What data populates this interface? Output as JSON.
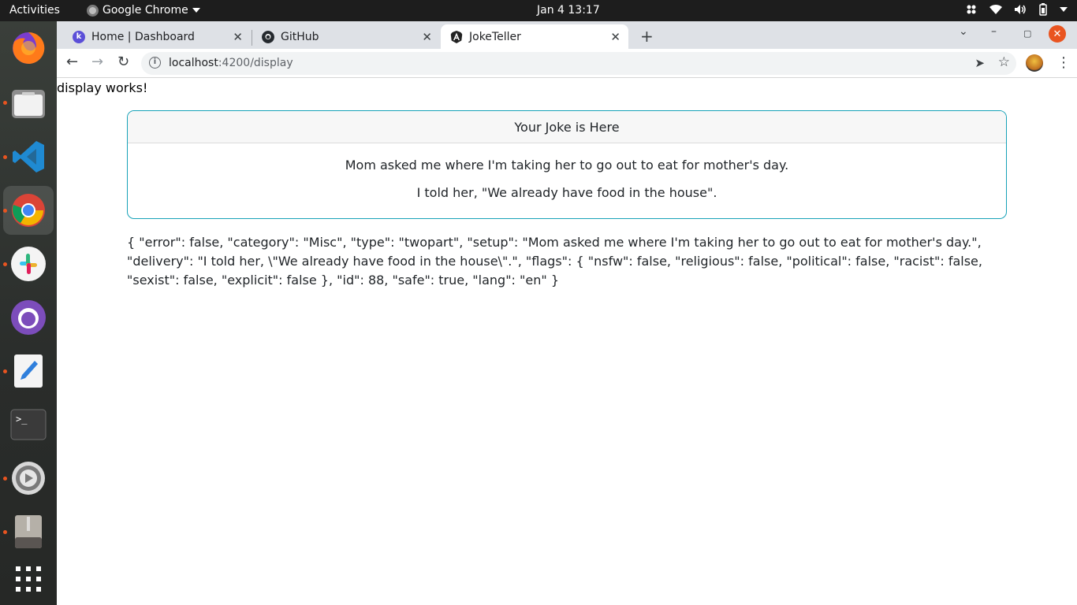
{
  "system": {
    "activities_label": "Activities",
    "app_menu_label": "Google Chrome",
    "clock": "Jan 4  13:17"
  },
  "dock": {
    "items": [
      "firefox",
      "files",
      "vscode",
      "chrome",
      "slack",
      "github-desktop",
      "text-editor",
      "terminal",
      "settings",
      "archive-manager",
      "show-apps"
    ]
  },
  "browser": {
    "tabs": [
      {
        "title": "Home | Dashboard",
        "favicon": "k"
      },
      {
        "title": "GitHub",
        "favicon": "github"
      },
      {
        "title": "JokeTeller",
        "favicon": "angular"
      }
    ],
    "url_host": "localhost",
    "url_path": ":4200/display"
  },
  "page": {
    "status_text": "display works!",
    "card_header": "Your Joke is Here",
    "setup": "Mom asked me where I'm taking her to go out to eat for mother's day.",
    "delivery": "I told her, \"We already have food in the house\".",
    "raw_json": "{ \"error\": false, \"category\": \"Misc\", \"type\": \"twopart\", \"setup\": \"Mom asked me where I'm taking her to go out to eat for mother's day.\", \"delivery\": \"I told her, \\\"We already have food in the house\\\".\", \"flags\": { \"nsfw\": false, \"religious\": false, \"political\": false, \"racist\": false, \"sexist\": false, \"explicit\": false }, \"id\": 88, \"safe\": true, \"lang\": \"en\" }"
  },
  "colors": {
    "card_border": "#17a2b8",
    "topbar": "#1d1d1d",
    "ubuntu_orange": "#e95420"
  }
}
